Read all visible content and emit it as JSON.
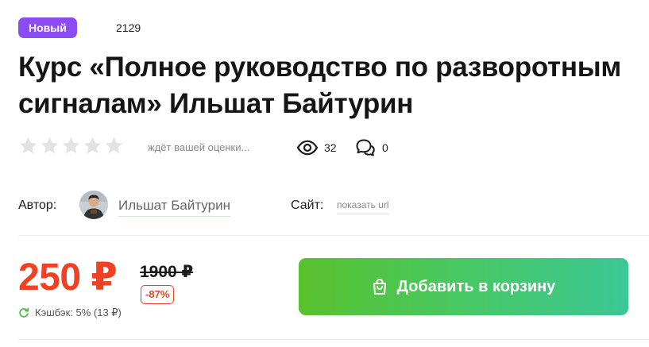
{
  "badge": "Новый",
  "product_id": "2129",
  "title": "Курс «Полное руководство по разворотным сигналам» Ильшат Байтурин",
  "rating": {
    "stars_filled": 0,
    "stars_total": 5,
    "text": "ждёт вашей оценки..."
  },
  "stats": {
    "views": "32",
    "comments": "0"
  },
  "author": {
    "label": "Автор:",
    "name": "Ильшат Байтурин"
  },
  "site": {
    "label": "Сайт:",
    "link_text": "показать url"
  },
  "pricing": {
    "price": "250 ₽",
    "old_price": "1900 ₽",
    "discount": "-87%",
    "cashback": "Кэшбэк: 5% (13 ₽)"
  },
  "cart_button": {
    "label": "Добавить в корзину"
  },
  "colors": {
    "badge": "#8c4cf3",
    "price": "#f04223",
    "button_start": "#59c22d",
    "button_end": "#3cc795",
    "star_empty": "#e3e3e3"
  }
}
